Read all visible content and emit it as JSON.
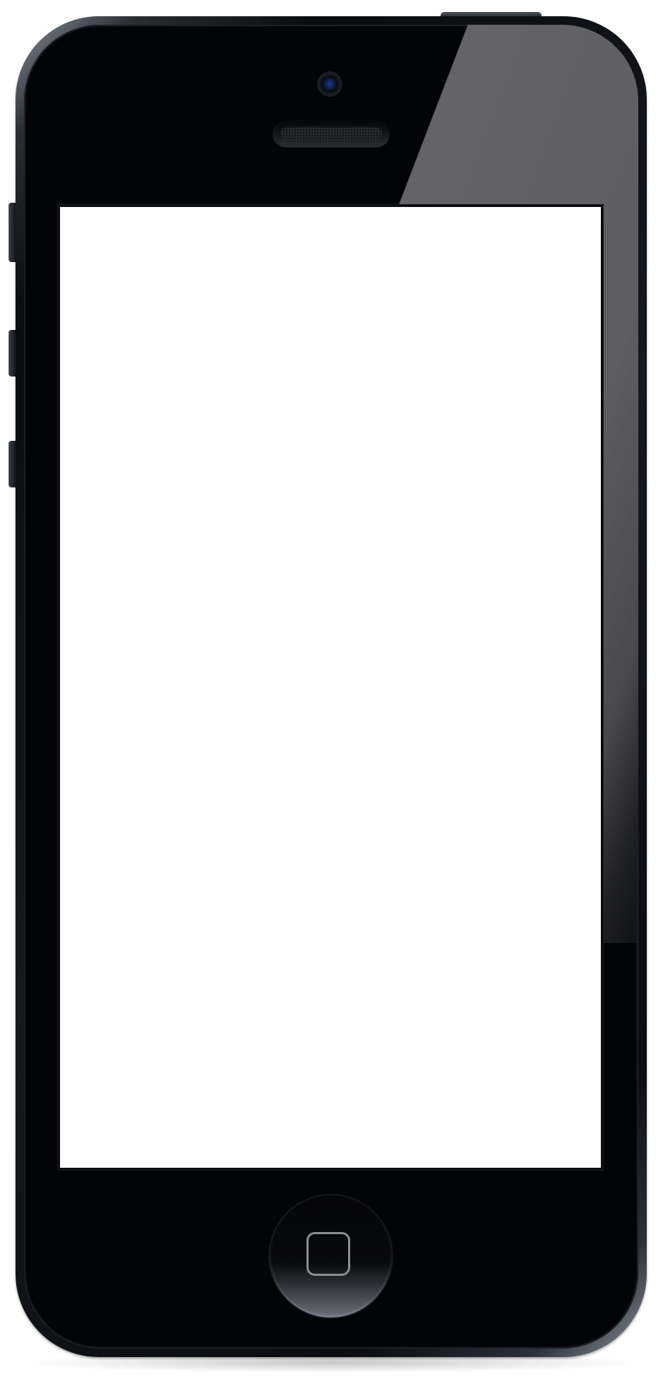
{
  "device": {
    "model": "smartphone-mockup",
    "body_color": "#020307",
    "band_color": "#8c939d",
    "screen_color": "#ffffff",
    "camera_lens_color": "#1c3a8c",
    "glare_color": "#646466"
  },
  "icons": {
    "camera": "front-camera-icon",
    "speaker": "earpiece-speaker-icon",
    "home": "home-button-icon"
  }
}
